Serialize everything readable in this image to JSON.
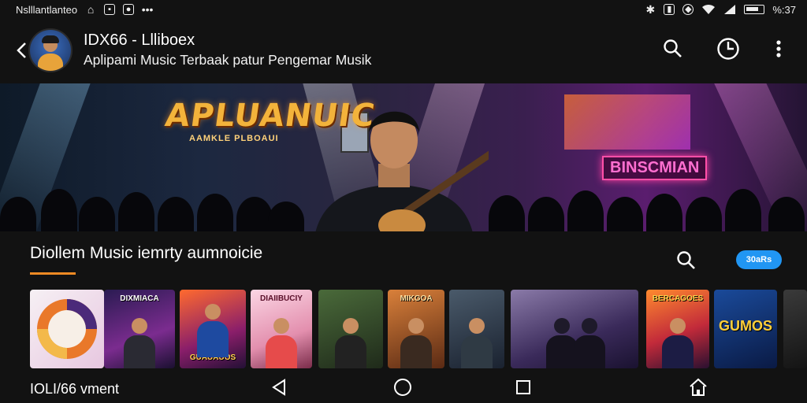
{
  "status_bar": {
    "carrier": "Nslllantlanteo",
    "time": "%:37",
    "left_icons": [
      "home-icon",
      "photo-icon",
      "app-icon",
      "dots-icon"
    ],
    "right_icons": [
      "bluetooth-icon",
      "sim-icon",
      "data-icon",
      "wifi-icon",
      "signal-icon",
      "battery-icon"
    ]
  },
  "app_bar": {
    "title": "IDX66 - Llliboex",
    "subtitle": "Aplipami Music Terbaak patur Pengemar Musik",
    "icons": [
      "back-arrow-icon",
      "search-icon",
      "history-icon",
      "more-vert-icon"
    ]
  },
  "banner": {
    "logo_text": "APLUANUIC",
    "logo_subtext": "AAMKLE PLBOAUI",
    "sign_text": "BINSCMIAN"
  },
  "section": {
    "title": "Diollem Music iemrty aumnoicie",
    "chip_label": "30aRs",
    "icons": [
      "search-icon"
    ]
  },
  "rail": {
    "tiles": [
      {
        "label": "",
        "kind": "logo"
      },
      {
        "label": "DIXMIACA",
        "kind": "poster"
      },
      {
        "label": "GUAUAUOS",
        "kind": "poster"
      },
      {
        "label": "DIAIIBUCIY",
        "kind": "poster"
      },
      {
        "label": "",
        "kind": "poster"
      },
      {
        "label": "MIKGOA",
        "kind": "poster"
      },
      {
        "label": "",
        "kind": "poster"
      },
      {
        "label": "",
        "kind": "poster"
      },
      {
        "label": "BERCAGOES",
        "kind": "poster"
      },
      {
        "label": "GUMOS",
        "kind": "poster"
      },
      {
        "label": "",
        "kind": "poster"
      }
    ]
  },
  "nav_bar": {
    "text": "IOLI/66 vment",
    "icons": [
      "nav-back-icon",
      "nav-home-icon",
      "nav-recents-icon",
      "house-icon"
    ]
  },
  "colors": {
    "background": "#121212",
    "accent_orange": "#f08a24",
    "chip_blue": "#2196f3"
  }
}
